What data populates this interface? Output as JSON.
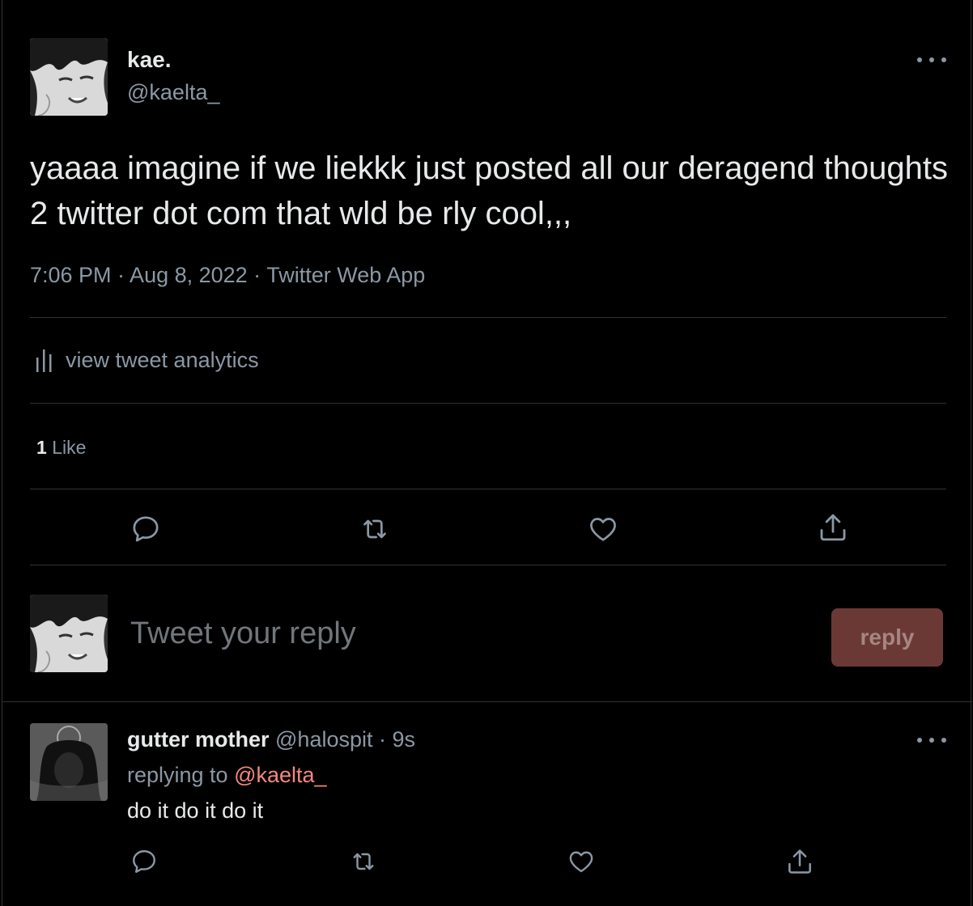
{
  "tweet": {
    "display_name": "kae.",
    "handle": "@kaelta_",
    "text": "yaaaa imagine if we liekkk just posted all our deragend thoughts 2 twitter dot com that wld be rly cool,,,",
    "meta": "7:06 PM · Aug 8, 2022 · Twitter Web App",
    "analytics_label": "view tweet analytics",
    "likes_count": "1",
    "likes_label": "Like"
  },
  "compose": {
    "placeholder": "Tweet your reply",
    "button_label": "reply"
  },
  "reply": {
    "display_name": "gutter mother",
    "handle": "@halospit",
    "separator": "·",
    "time": "9s",
    "replying_prefix": "replying to",
    "replying_to": "@kaelta_",
    "text": "do it do it do it"
  },
  "icons": {
    "more": "more-horizontal-icon",
    "analytics": "analytics-icon",
    "reply": "speech-bubble-icon",
    "retweet": "retweet-icon",
    "like": "heart-icon",
    "share": "share-icon"
  },
  "colors": {
    "background": "#000000",
    "text": "#e7e9ea",
    "muted": "#8b98a5",
    "border": "#2f3336",
    "mention": "#f4897b",
    "reply_button_bg": "#6b3935",
    "reply_button_text": "#a58682"
  }
}
